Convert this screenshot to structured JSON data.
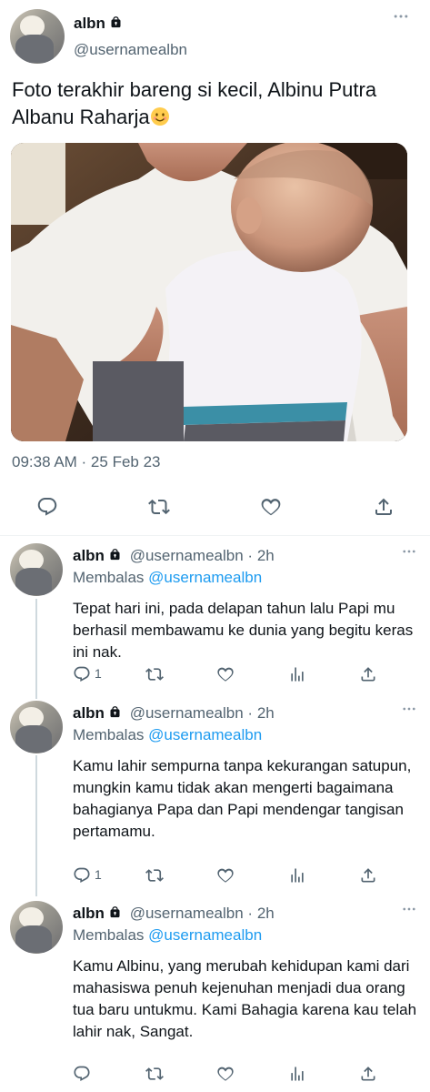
{
  "main_tweet": {
    "display_name": "albn",
    "handle": "@usernamealbn",
    "text": "Foto terakhir bareng si kecil, Albinu Putra Albanu Raharja",
    "timestamp": "09:38 AM · 25 Feb 23",
    "icons": {
      "lock": "lock-icon",
      "emoji": "smiling-face-emoji",
      "more": "more-icon",
      "reply": "reply-icon",
      "retweet": "retweet-icon",
      "like": "like-icon",
      "share": "share-icon"
    }
  },
  "replies": [
    {
      "display_name": "albn",
      "handle": "@usernamealbn",
      "time": "2h",
      "replying_label": "Membalas",
      "replying_to": "@usernamealbn",
      "text": "Tepat hari ini, pada delapan tahun lalu Papi mu berhasil membawamu ke dunia yang begitu keras ini nak.",
      "reply_count": "1"
    },
    {
      "display_name": "albn",
      "handle": "@usernamealbn",
      "time": "2h",
      "replying_label": "Membalas",
      "replying_to": "@usernamealbn",
      "text": "Kamu lahir sempurna tanpa kekurangan satupun, mungkin kamu tidak akan mengerti bagaimana bahagianya Papa dan Papi mendengar tangisan pertamamu.",
      "reply_count": "1"
    },
    {
      "display_name": "albn",
      "handle": "@usernamealbn",
      "time": "2h",
      "replying_label": "Membalas",
      "replying_to": "@usernamealbn",
      "text": "Kamu Albinu, yang merubah kehidupan kami dari mahasiswa penuh kejenuhan menjadi dua orang tua baru untukmu. Kami Bahagia karena kau telah lahir nak, Sangat.",
      "reply_count": ""
    }
  ],
  "reply_icons": [
    "reply-icon",
    "retweet-icon",
    "like-icon",
    "views-icon",
    "share-icon"
  ],
  "colors": {
    "text": "#0f1419",
    "secondary": "#536471",
    "mention": "#1d9bf0",
    "divider": "#eff3f4",
    "thread_line": "#cfd9de"
  }
}
